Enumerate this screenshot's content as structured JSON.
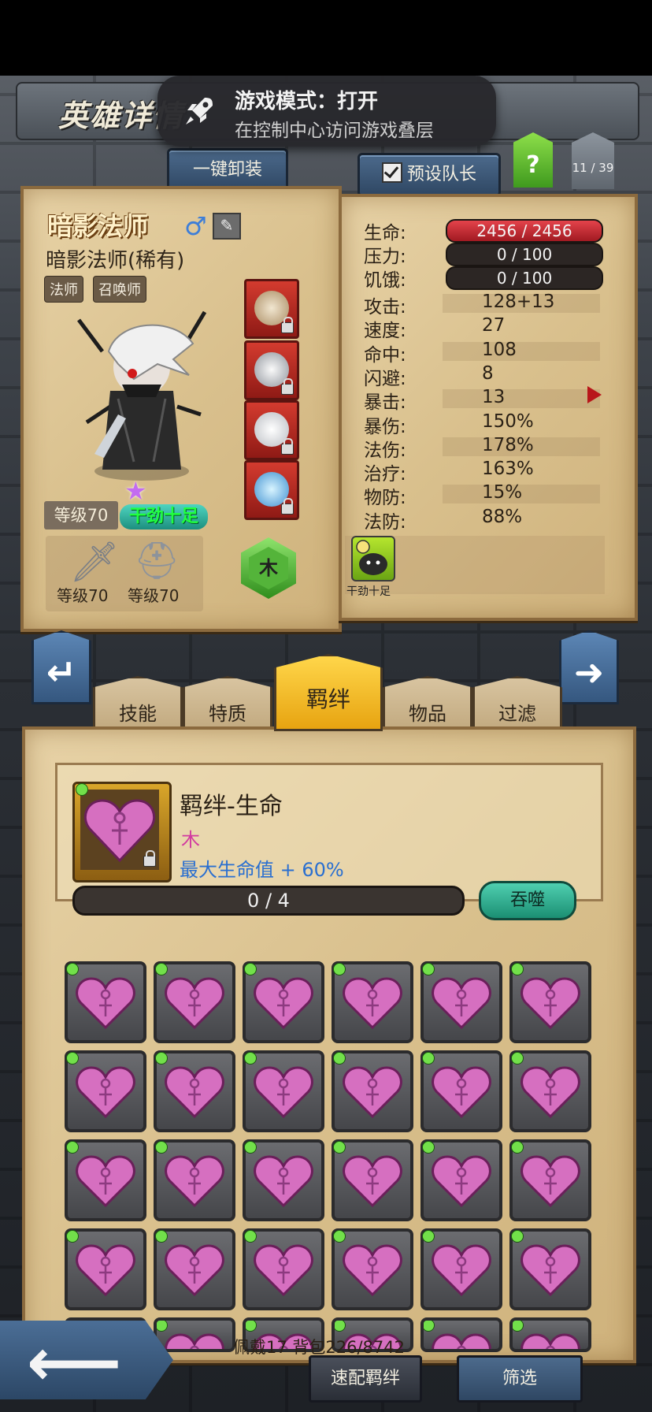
{
  "header": {
    "title": "英雄详情",
    "unequip_all": "一键卸装",
    "preset_leader": "预设队长",
    "help": "?",
    "page_counter": "11 / 39"
  },
  "toast": {
    "title": "游戏模式：打开",
    "subtitle": "在控制中心访问游戏叠层"
  },
  "hero": {
    "name": "暗影法师",
    "gender_symbol": "♂",
    "class_full": "暗影法师(稀有)",
    "tags": [
      "法师",
      "召唤师"
    ],
    "level": "等级70",
    "trait": "干劲十足",
    "weapon_level": "等级70",
    "armor_level": "等级70",
    "element": "木"
  },
  "stats": {
    "hp": {
      "label": "生命:",
      "value": "2456 / 2456"
    },
    "stress": {
      "label": "压力:",
      "value": "0 / 100"
    },
    "hunger": {
      "label": "饥饿:",
      "value": "0 / 100"
    },
    "rows": [
      {
        "label": "攻击:",
        "value": "128+13"
      },
      {
        "label": "速度:",
        "value": "27"
      },
      {
        "label": "命中:",
        "value": "108"
      },
      {
        "label": "闪避:",
        "value": "8"
      },
      {
        "label": "暴击:",
        "value": "13"
      },
      {
        "label": "暴伤:",
        "value": "150%"
      },
      {
        "label": "法伤:",
        "value": "178%"
      },
      {
        "label": "治疗:",
        "value": "163%"
      },
      {
        "label": "物防:",
        "value": "15%"
      },
      {
        "label": "法防:",
        "value": "88%"
      }
    ],
    "passive_label": "干劲十足"
  },
  "tabs": [
    {
      "label": "技能"
    },
    {
      "label": "特质"
    },
    {
      "label": "羁绊"
    },
    {
      "label": "物品"
    },
    {
      "label": "过滤"
    }
  ],
  "bond": {
    "name": "羁绊-生命",
    "element": "木",
    "effect": "最大生命值 + 60%",
    "progress": "0 / 4",
    "devour": "吞噬"
  },
  "footer": {
    "summary": "佩戴17 背包226/8742",
    "quick_bond": "速配羁绊",
    "screen": "筛选"
  },
  "colors": {
    "accent_gold": "#e7a411",
    "hp_red": "#d03038",
    "gem_pink": "#d66fc0",
    "parchment": "#d9c08d",
    "slate_blue": "#35577f"
  },
  "icons": {
    "toast": "rocket-icon",
    "gender": "male-icon",
    "rename": "edit-icon",
    "weapon": "sword-icon",
    "armor": "helmet-icon",
    "gem": "heart-gem-icon",
    "back": "back-arrow-icon"
  }
}
